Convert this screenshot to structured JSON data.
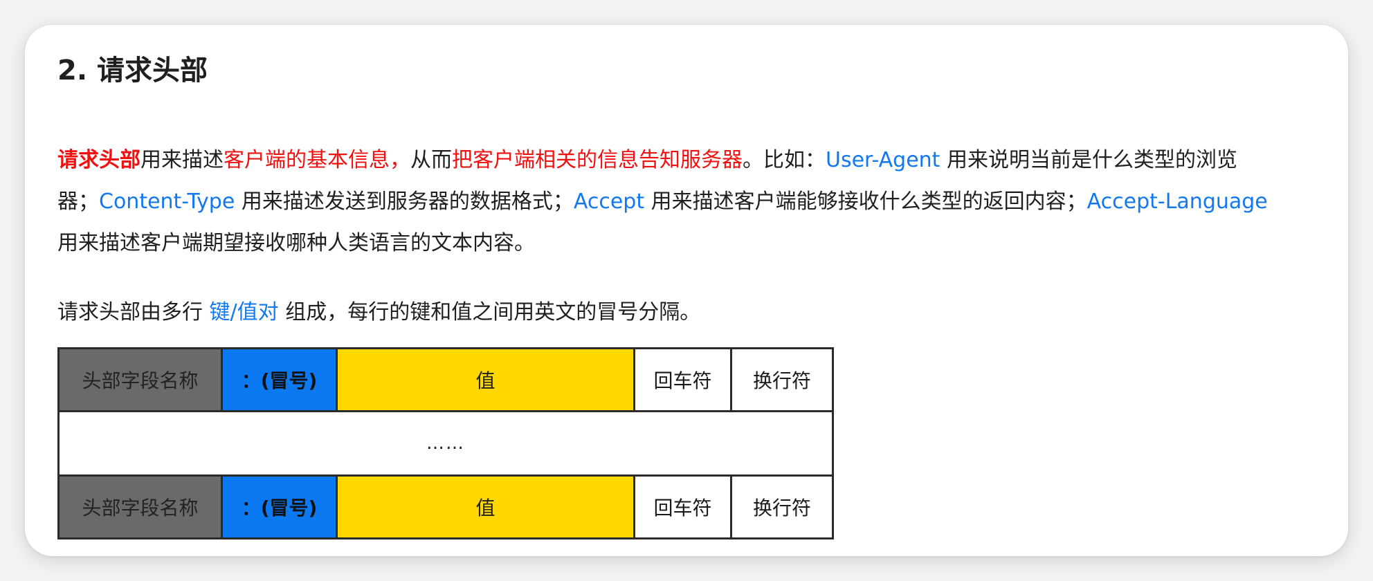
{
  "section": {
    "title": "2. 请求头部"
  },
  "paragraph1": {
    "p1": "请求头部",
    "p2": "用来描述",
    "p3": "客户端的基本信息，",
    "p4": "从而",
    "p5": "把客户端相关的信息告知服务器",
    "p6": "。比如：",
    "p7": "User-Agent",
    "p8": " 用来说明当前是什么类型的浏览器；",
    "p9": "Content-Type",
    "p10": " 用来描述发送到服务器的数据格式；",
    "p11": "Accept",
    "p12": " 用来描述客户端能够接收什么类型的返回内容；",
    "p13": "Accept-Language",
    "p14": " 用来描述客户端期望接收哪种人类语言的文本内容。"
  },
  "paragraph2": {
    "p1": "请求头部由多行 ",
    "p2": "键/值对",
    "p3": " 组成，每行的键和值之间用英文的冒号分隔。"
  },
  "table": {
    "rows": [
      {
        "name": "头部字段名称",
        "colon": "：(冒号)",
        "value": "值",
        "cr": "回车符",
        "lf": "换行符"
      },
      {
        "name": "头部字段名称",
        "colon": "：(冒号)",
        "value": "值",
        "cr": "回车符",
        "lf": "换行符"
      }
    ],
    "ellipsis": "……"
  },
  "colors": {
    "name_cell": "#6a6a6a",
    "colon_cell": "#0a79f2",
    "value_cell": "#ffd800",
    "highlight_red": "#f20f0f",
    "highlight_blue": "#1178f2"
  }
}
